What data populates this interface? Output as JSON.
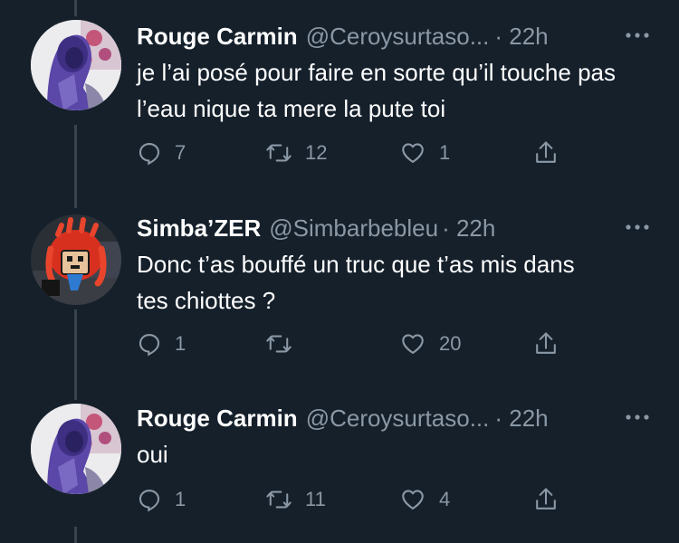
{
  "tweets": [
    {
      "name": "Rouge Carmin",
      "handle": "@Ceroysurtaso...",
      "time": "· 22h",
      "text": "je l’ai posé pour faire en sorte qu’il touche pas l’eau nique ta mere la pute toi",
      "replies": "7",
      "retweets": "12",
      "likes": "1",
      "avatar": "purple-hooded-figure-avatar"
    },
    {
      "name": "Simba’ZER",
      "handle": "@Simbarbebleu",
      "time": "· 22h",
      "text": "Donc t’as bouffé un truc que t’as mis dans tes chiottes ?",
      "replies": "1",
      "retweets": "",
      "likes": "20",
      "avatar": "red-dreadlocks-character-avatar"
    },
    {
      "name": "Rouge Carmin",
      "handle": "@Ceroysurtaso...",
      "time": "· 22h",
      "text": "oui",
      "replies": "1",
      "retweets": "11",
      "likes": "4",
      "avatar": "purple-hooded-figure-avatar"
    }
  ],
  "colors": {
    "background": "#15202b",
    "text_primary": "#ffffff",
    "text_secondary": "#8b98a5",
    "thread_line": "#38444d"
  }
}
